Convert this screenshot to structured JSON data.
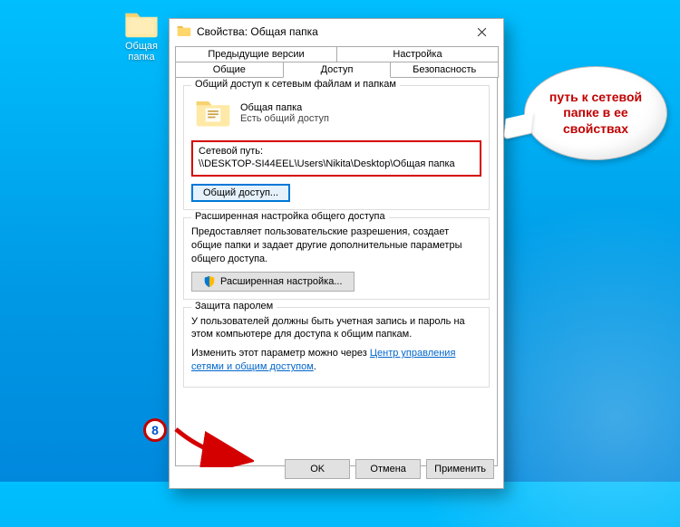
{
  "desktop": {
    "folder_label": "Общая папка"
  },
  "dialog": {
    "title": "Свойства: Общая папка",
    "tabs_row1": [
      "Предыдущие версии",
      "Настройка"
    ],
    "tabs_row2": [
      "Общие",
      "Доступ",
      "Безопасность"
    ],
    "active_tab": "Доступ",
    "group1": {
      "legend": "Общий доступ к сетевым файлам и папкам",
      "folder_name": "Общая папка",
      "share_status": "Есть общий доступ",
      "netpath_label": "Сетевой путь:",
      "netpath_value": "\\\\DESKTOP-SI44EEL\\Users\\Nikita\\Desktop\\Общая папка",
      "share_button": "Общий доступ..."
    },
    "group2": {
      "legend": "Расширенная настройка общего доступа",
      "desc": "Предоставляет пользовательские разрешения, создает общие папки и задает другие дополнительные параметры общего доступа.",
      "adv_button": "Расширенная настройка..."
    },
    "group3": {
      "legend": "Защита паролем",
      "desc": "У пользователей должны быть учетная запись и пароль на этом компьютере для доступа к общим папкам.",
      "change_prefix": "Изменить этот параметр можно через ",
      "link_text": "Центр управления сетями и общим доступом",
      "dot": "."
    },
    "buttons": {
      "ok": "OK",
      "cancel": "Отмена",
      "apply": "Применить"
    }
  },
  "callout": {
    "text": "путь к сетевой папке в ее свойствах"
  },
  "badge": {
    "number": "8"
  }
}
